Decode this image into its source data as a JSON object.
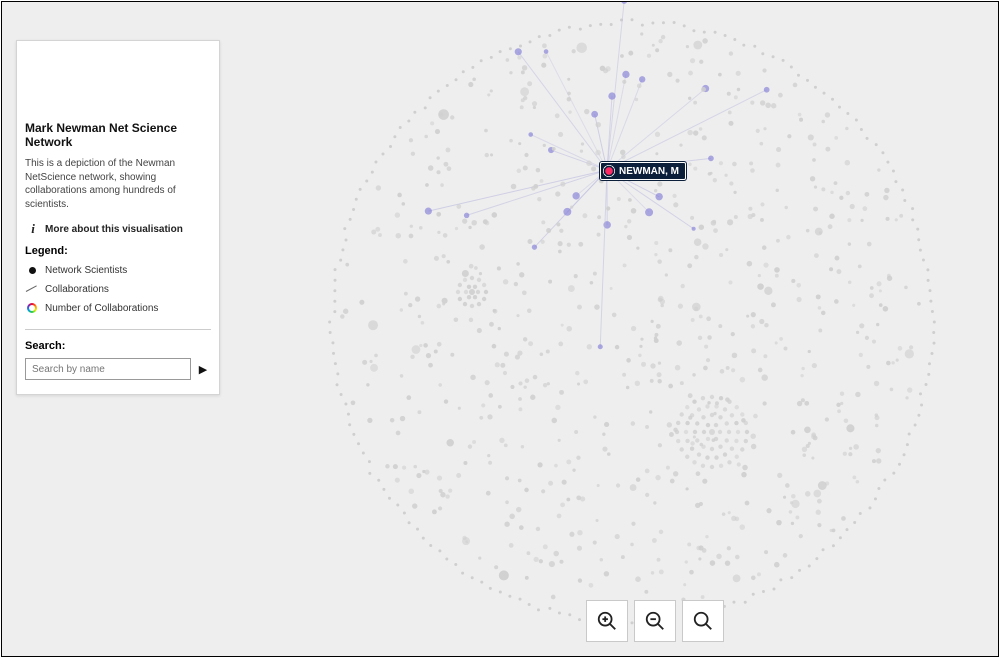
{
  "sidebar": {
    "title": "Mark Newman Net Science Network",
    "description": "This is a depiction of the Newman NetScience network, showing collaborations among hundreds of scientists.",
    "more_link": "More about this visualisation",
    "legend_heading": "Legend:",
    "legend_items": {
      "nodes": "Network Scientists",
      "edges": "Collaborations",
      "weight": "Number of Collaborations"
    },
    "search_heading": "Search:",
    "search_placeholder": "Search by name"
  },
  "network": {
    "highlighted_node_label": "NEWMAN, M"
  },
  "controls": {
    "zoom_in": "Zoom in",
    "zoom_out": "Zoom out",
    "zoom_fit": "Fit to screen"
  }
}
